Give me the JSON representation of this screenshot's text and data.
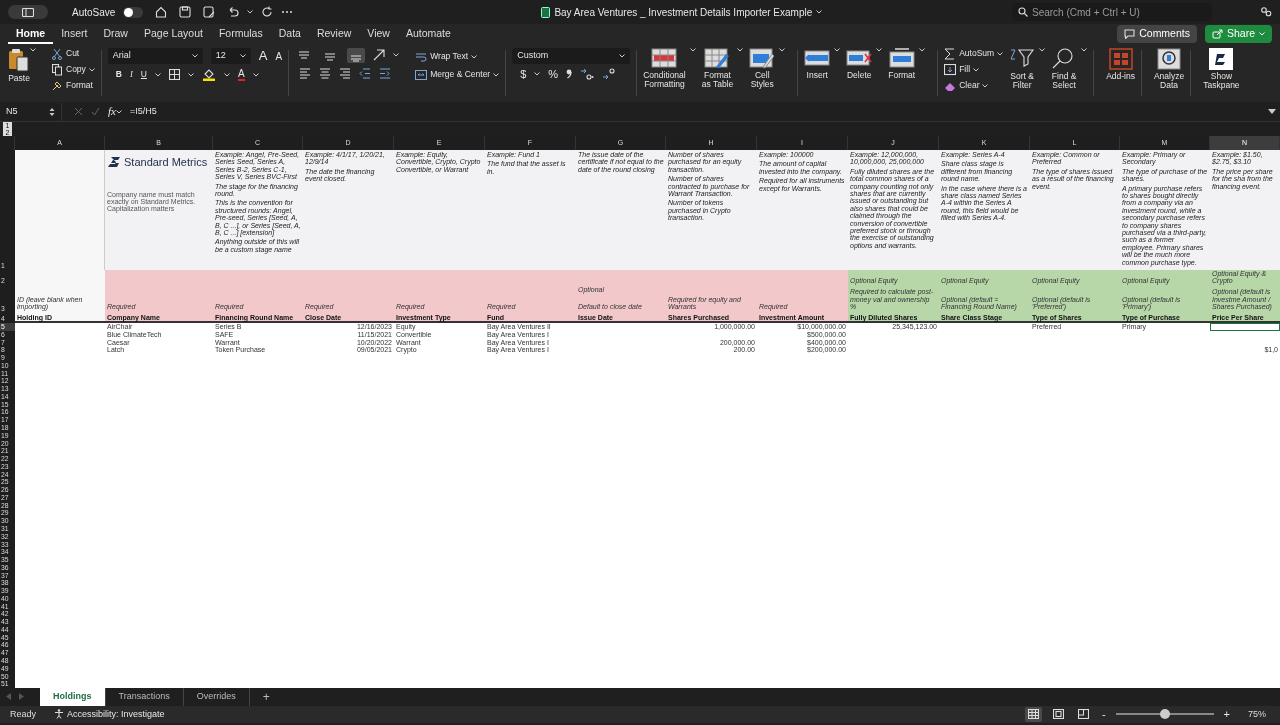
{
  "title_bar": {
    "autosave": {
      "label": "AutoSave",
      "on": false
    },
    "document_title": "Bay Area Ventures _ Investment Details Importer Example",
    "search": {
      "placeholder": "Search (Cmd + Ctrl + U)"
    }
  },
  "menu_tabs": [
    {
      "label": "Home",
      "selected": true
    },
    {
      "label": "Insert",
      "selected": false
    },
    {
      "label": "Draw",
      "selected": false
    },
    {
      "label": "Page Layout",
      "selected": false
    },
    {
      "label": "Formulas",
      "selected": false
    },
    {
      "label": "Data",
      "selected": false
    },
    {
      "label": "Review",
      "selected": false
    },
    {
      "label": "View",
      "selected": false
    },
    {
      "label": "Automate",
      "selected": false
    }
  ],
  "header_buttons": {
    "comments": "Comments",
    "share": "Share"
  },
  "ribbon": {
    "clipboard": {
      "paste": "Paste",
      "items": [
        "Cut",
        "Copy",
        "Format"
      ]
    },
    "font": {
      "name": "Arial",
      "size": "12",
      "grow": "A",
      "shrink": "A",
      "bold": "B",
      "italic": "I",
      "underline": "U",
      "font_color": "A"
    },
    "vertical_align": [
      {
        "selected": false
      },
      {
        "selected": false
      },
      {
        "selected": true
      }
    ],
    "alignment": {
      "wrap": "Wrap Text",
      "merge": "Merge & Center"
    },
    "number": {
      "format": "Custom",
      "currency": "$",
      "percent": "%"
    },
    "large_buttons": [
      {
        "lines": [
          "Conditional",
          "Formatting"
        ]
      },
      {
        "lines": [
          "Format",
          "as Table"
        ]
      },
      {
        "lines": [
          "Cell",
          "Styles"
        ]
      },
      {
        "lines": [
          "Insert"
        ]
      },
      {
        "lines": [
          "Delete"
        ]
      },
      {
        "lines": [
          "Format"
        ]
      }
    ],
    "editing": [
      "AutoSum",
      "Fill",
      "Clear"
    ],
    "right_buttons": [
      {
        "lines": [
          "Sort &",
          "Filter"
        ]
      },
      {
        "lines": [
          "Find &",
          "Select"
        ]
      },
      {
        "lines": [
          "Add-ins"
        ]
      },
      {
        "lines": [
          "Analyze",
          "Data"
        ]
      },
      {
        "lines": [
          "Show",
          "Taskpane"
        ]
      }
    ]
  },
  "formula_bar": {
    "cell": "N5",
    "fx": "fx",
    "formula": "=I5/H5"
  },
  "outline_levels": [
    "1",
    "2"
  ],
  "columns": [
    {
      "letter": "A",
      "kind": "note",
      "color": "#f7f7f7",
      "selected": false,
      "numeric": false,
      "row3": {
        "lines": [
          "ID (leave blank when importing)"
        ]
      },
      "heading": "Holding ID"
    },
    {
      "letter": "B",
      "kind": "logo",
      "logo": "Standard Metrics",
      "color": "#f3c8cb",
      "selected": false,
      "numeric": false,
      "notes": [
        "Company name must match exactly on Standard Metrics. Capitalization matters"
      ],
      "row3": {
        "lines": [
          "Required"
        ]
      },
      "heading": "Company Name"
    },
    {
      "letter": "C",
      "kind": "note",
      "color": "#f3c8cb",
      "selected": false,
      "numeric": false,
      "notes": [
        "Example: Angel, Pre-Seed, Series Seed, Series A, Series B-2, Series C-1, Series V, Series  BVC-First",
        "The stage for the financing round.",
        "This is the convention for structured rounds:  Angel, Pre-seed, Series [Seed, A, B, C ...], or Series [Seed, A, B, C ...] [extension]",
        "Anything outside of this will be a custom stage name"
      ],
      "row3": {
        "lines": [
          "Required"
        ]
      },
      "heading": "Financing Round Name"
    },
    {
      "letter": "D",
      "kind": "note",
      "color": "#f3c8cb",
      "selected": false,
      "numeric": true,
      "notes": [
        "Example: 4/1/17, 1/20/21, 12/9/14",
        "The date the financing event closed."
      ],
      "row3": {
        "lines": [
          "Required"
        ]
      },
      "heading": "Close Date"
    },
    {
      "letter": "E",
      "kind": "note",
      "color": "#f3c8cb",
      "selected": false,
      "numeric": false,
      "notes": [
        "Example: Equity, Convertible, Crypto, Crypto Convertible, or Warrant"
      ],
      "row3": {
        "lines": [
          "Required"
        ]
      },
      "heading": "Investment Type"
    },
    {
      "letter": "F",
      "kind": "note",
      "color": "#f3c8cb",
      "selected": false,
      "numeric": false,
      "notes": [
        "Example: Fund 1",
        "The fund that the asset is in."
      ],
      "row3": {
        "lines": [
          "Required"
        ]
      },
      "heading": "Fund"
    },
    {
      "letter": "G",
      "kind": "note",
      "color": "#f3c8cb",
      "selected": false,
      "numeric": false,
      "notes": [
        "The issue date of the certificate if not equal to the date of the round closing"
      ],
      "row3": {
        "top": "Optional",
        "lines": [
          "Default to close date"
        ]
      },
      "heading": "Issue Date"
    },
    {
      "letter": "H",
      "kind": "note",
      "color": "#f3c8cb",
      "selected": false,
      "numeric": true,
      "notes": [
        "Number of shares purchased for an equity transaction.",
        "Number of shares contracted to purchase for Warrant Transaction.",
        "Number of tokens purchased in Crypto transaction."
      ],
      "row3": {
        "lines": [
          "Required for equity and Warrants"
        ]
      },
      "heading": "Shares Purchased"
    },
    {
      "letter": "I",
      "kind": "note",
      "color": "#f3c8cb",
      "selected": false,
      "numeric": true,
      "notes": [
        "Example: 100000",
        "The amount of capital invested into the company.",
        "Required for all instruments except for Warrants."
      ],
      "row3": {
        "lines": [
          "Required"
        ]
      },
      "heading": "Investment Amount"
    },
    {
      "letter": "J",
      "kind": "note",
      "color": "#b7d7a9",
      "selected": false,
      "numeric": true,
      "notes": [
        "Example: 12,000,000, 10,000,000, 25,000,000",
        "Fully diluted shares are the total common shares of a company counting not only shares that are currently issued or outstanding but also shares that could be claimed through the conversion of convertible preferred stock or through the exercise of outstanding options and warrants."
      ],
      "row2": "Optional Equity",
      "row3": {
        "lines": [
          "Required to calculate post-money val and ownership %"
        ]
      },
      "heading": "Fully Diluted Shares"
    },
    {
      "letter": "K",
      "kind": "note",
      "color": "#b7d7a9",
      "selected": false,
      "numeric": false,
      "notes": [
        "Example: Series A-4",
        "Share class stage is different from financing round name.",
        "In the case where there is a share class named Series A-4 within the Series A round, this field would be filled with Series A-4."
      ],
      "row2": "Optional Equity",
      "row3": {
        "lines": [
          "Optional (default = Financing Round Name)"
        ]
      },
      "heading": "Share Class Stage"
    },
    {
      "letter": "L",
      "kind": "note",
      "color": "#b7d7a9",
      "selected": false,
      "numeric": false,
      "notes": [
        "Example: Common or Preferred",
        "The type of shares issued as a result of the financing event."
      ],
      "row2": "Optional Equity",
      "row3": {
        "lines": [
          "Optional (default is 'Preferred')"
        ]
      },
      "heading": "Type of Shares"
    },
    {
      "letter": "M",
      "kind": "note",
      "color": "#b7d7a9",
      "selected": false,
      "numeric": false,
      "notes": [
        "Example: Primary or Secondary",
        "The type of purchase of the shares.",
        "A primary purchase refers to shares bought directly from a company via an investment round, while a secondary purchase refers to company shares purchased via a third-party, such as a former employee. Primary shares will be the much more common purchase type."
      ],
      "row2": "Optional Equity",
      "row3": {
        "lines": [
          "Optional (default is 'Primary')"
        ]
      },
      "heading": "Type of Purchase"
    },
    {
      "letter": "N",
      "kind": "note",
      "color": "#b7d7a9",
      "selected": true,
      "numeric": true,
      "notes": [
        "Example: $1.50, $2.75, $3.10",
        "The price per share for the sha from the financing event."
      ],
      "row2": "Optional Equity & Crypto",
      "row3": {
        "lines": [
          "Optional (default is Investme Amount / Shares Purchased)"
        ]
      },
      "heading": "Price Per Share"
    }
  ],
  "header_row_numbers": [
    "1",
    "2",
    "3",
    "4"
  ],
  "rows": [
    {
      "number": "5",
      "selected": true,
      "cells": [
        null,
        "AirChair",
        "Series B",
        "12/16/2023",
        "Equity",
        "Bay Area Ventures II",
        null,
        "1,000,000.00",
        "$10,000,000.00",
        "25,345,123.00",
        null,
        "Preferred",
        "Primary",
        null
      ]
    },
    {
      "number": "6",
      "selected": false,
      "cells": [
        null,
        "Blue ClimateTech",
        "SAFE",
        "11/15/2021",
        "Convertible",
        "Bay Area Ventures I",
        null,
        null,
        "$500,000.00",
        null,
        null,
        null,
        null,
        null
      ]
    },
    {
      "number": "7",
      "selected": false,
      "cells": [
        null,
        "Caesar",
        "Warrant",
        "10/20/2022",
        "Warrant",
        "Bay Area Ventures I",
        null,
        "200,000.00",
        "$400,000.00",
        null,
        null,
        null,
        null,
        null
      ]
    },
    {
      "number": "8",
      "selected": false,
      "cells": [
        null,
        "Latch",
        "Token Purchase",
        "09/05/2021",
        "Crypto",
        "Bay Area Ventures I",
        null,
        "200.00",
        "$200,000.00",
        null,
        null,
        null,
        null,
        "$1,0"
      ]
    }
  ],
  "empty_rows": [
    "9",
    "10",
    "11",
    "12",
    "13",
    "14",
    "15",
    "16",
    "17",
    "18",
    "19",
    "20",
    "21",
    "22",
    "23",
    "24",
    "25",
    "26",
    "27",
    "28",
    "29",
    "30",
    "31",
    "32",
    "33",
    "34",
    "35",
    "36",
    "37",
    "38",
    "39",
    "40",
    "41",
    "42",
    "43",
    "44",
    "45",
    "46",
    "47",
    "48",
    "49",
    "50",
    "51"
  ],
  "sheet_tabs": [
    {
      "label": "Holdings",
      "selected": true
    },
    {
      "label": "Transactions",
      "selected": false
    },
    {
      "label": "Overrides",
      "selected": false
    }
  ],
  "add_sheet": "+",
  "status_bar": {
    "ready": "Ready",
    "accessibility": "Accessibility: Investigate",
    "zoom": {
      "minus": "-",
      "plus": "+",
      "level": 0.5,
      "reading": "75%"
    },
    "views": [
      {
        "selected": true
      },
      {
        "selected": false
      },
      {
        "selected": false
      }
    ]
  }
}
